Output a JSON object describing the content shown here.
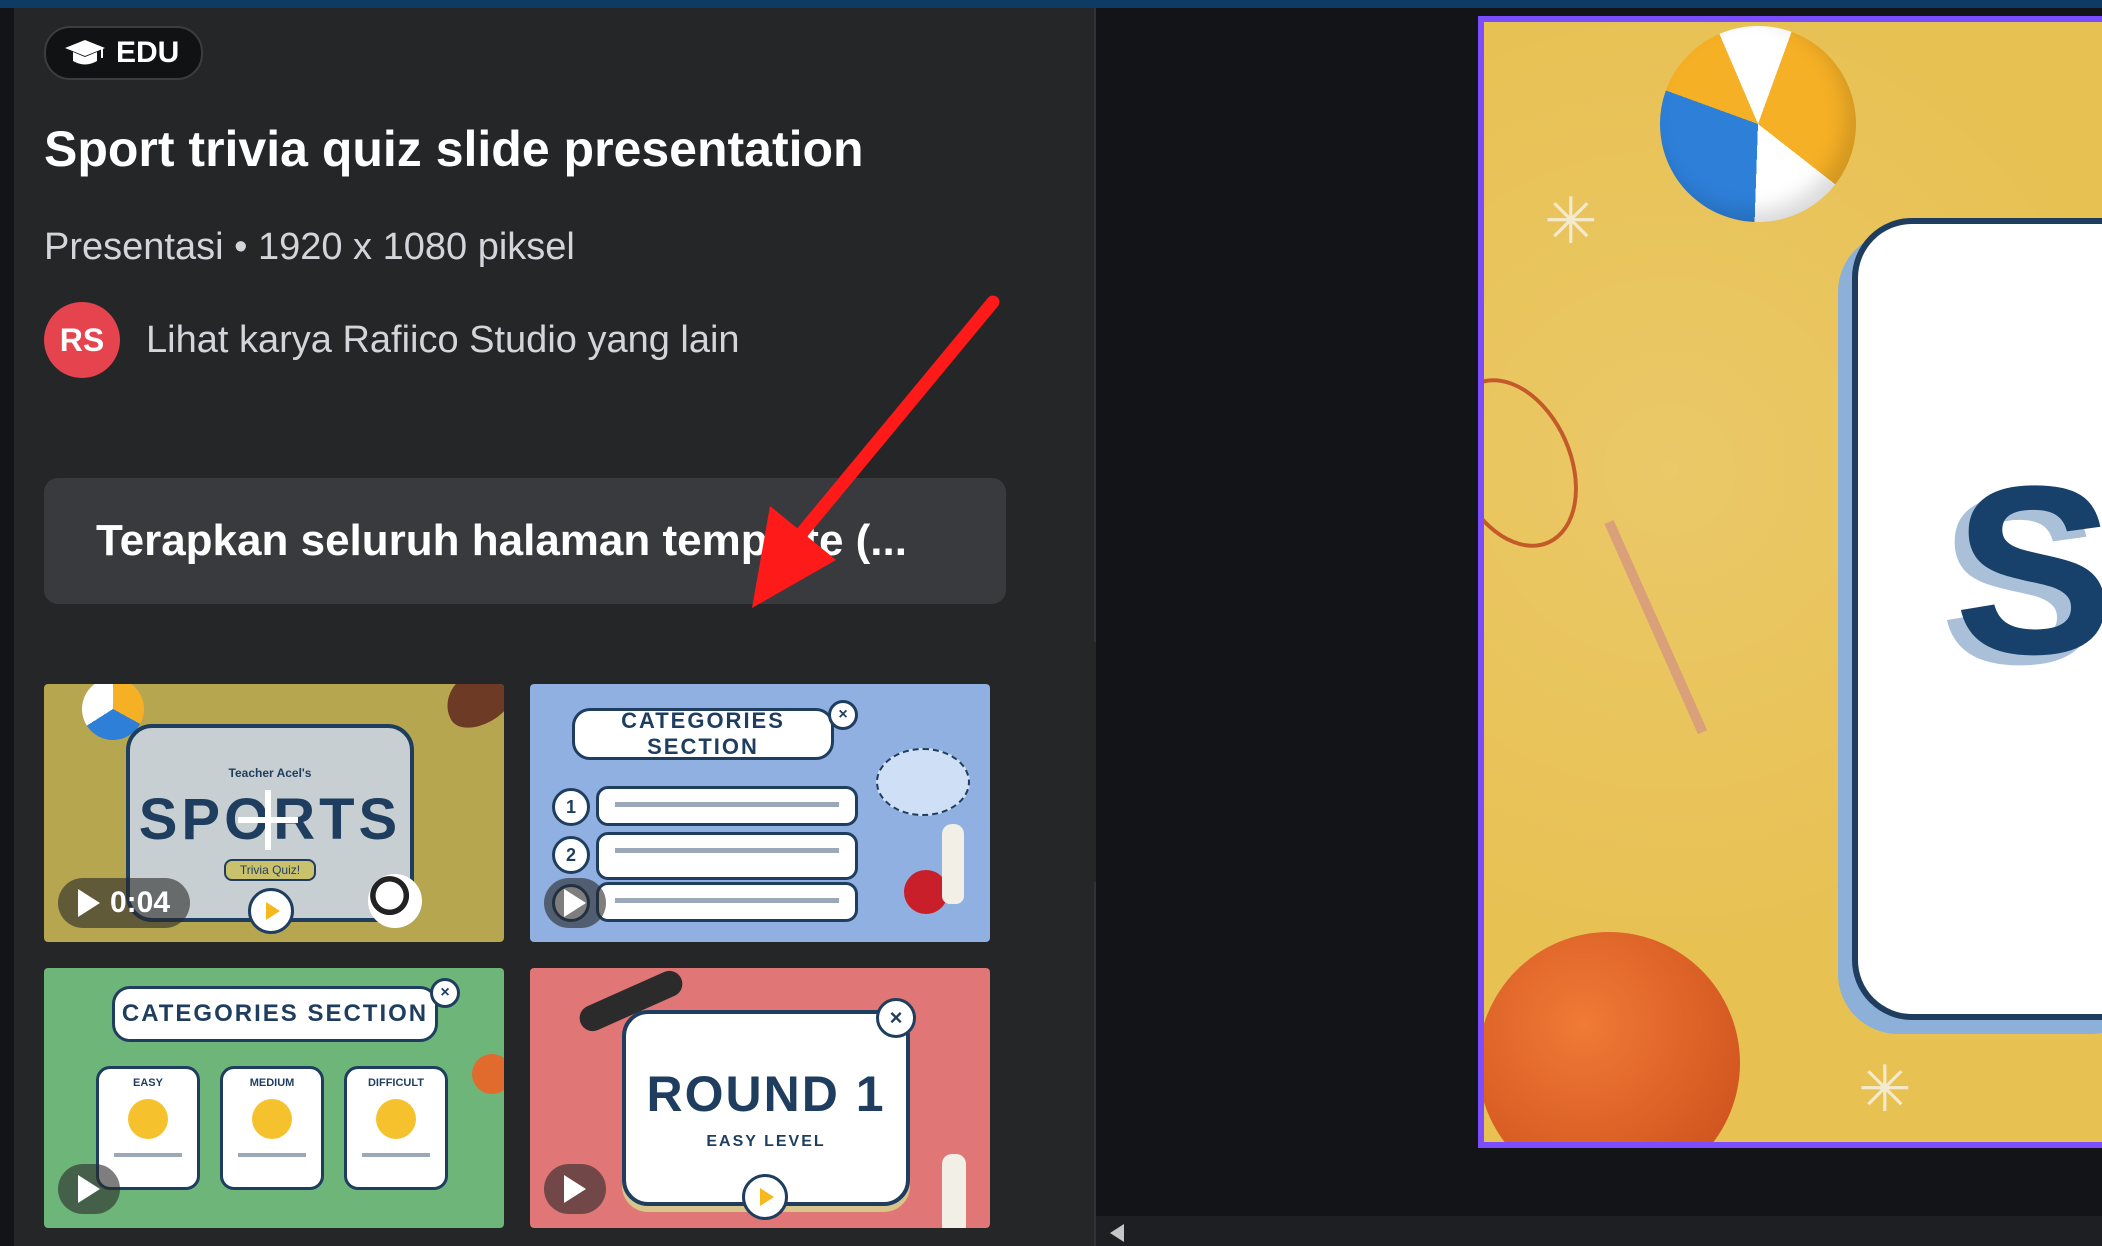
{
  "badge": {
    "icon": "graduation-cap-icon",
    "label": "EDU"
  },
  "template": {
    "title": "Sport trivia quiz slide presentation",
    "meta": "Presentasi • 1920 x 1080 piksel"
  },
  "author": {
    "initials": "RS",
    "link_text": "Lihat karya Rafiico Studio yang lain",
    "avatar_color": "#e5434d"
  },
  "apply_button": {
    "label": "Terapkan seluruh halaman template (..."
  },
  "annotation": {
    "arrow_color": "#ff1a1a"
  },
  "thumbnails": [
    {
      "kind": "title",
      "small": "Teacher Acel's",
      "big": "SPORTS",
      "pill": "Trivia Quiz!",
      "duration": "0:04"
    },
    {
      "kind": "categories-list",
      "heading": "CATEGORIES SECTION",
      "numbers": [
        "1",
        "2",
        "3"
      ]
    },
    {
      "kind": "categories-cards",
      "heading": "CATEGORIES SECTION",
      "cards": [
        "EASY",
        "MEDIUM",
        "DIFFICULT"
      ]
    },
    {
      "kind": "round",
      "big": "ROUND 1",
      "small": "EASY LEVEL"
    }
  ],
  "collapse_icon": "chevron-left-icon",
  "canvas": {
    "slide_letter": "S",
    "selection_color": "#7c4dff"
  },
  "scrollbar": {
    "left_arrow_icon": "scroll-left-icon"
  }
}
